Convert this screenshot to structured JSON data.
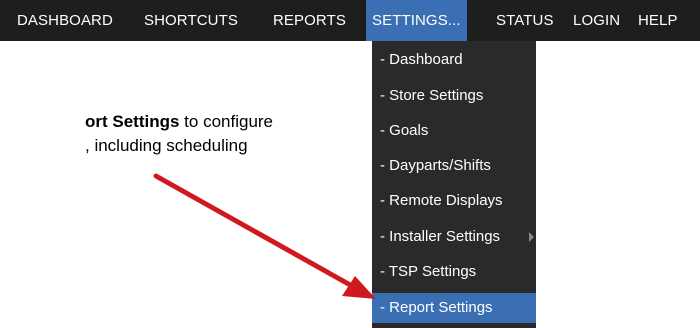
{
  "nav": {
    "items": [
      {
        "label": "DASHBOARD"
      },
      {
        "label": "SHORTCUTS"
      },
      {
        "label": "REPORTS"
      },
      {
        "label": "SETTINGS..."
      },
      {
        "label": "STATUS"
      },
      {
        "label": "LOGIN"
      },
      {
        "label": "HELP"
      }
    ],
    "active": "SETTINGS..."
  },
  "dropdown": {
    "items": [
      {
        "label": "- Dashboard"
      },
      {
        "label": "- Store Settings"
      },
      {
        "label": "- Goals"
      },
      {
        "label": "- Dayparts/Shifts"
      },
      {
        "label": "- Remote Displays"
      },
      {
        "label": "- Installer Settings"
      },
      {
        "label": "- TSP Settings"
      },
      {
        "label": "- Report Settings"
      }
    ],
    "highlighted": "- Report Settings"
  },
  "instruction": {
    "bold_part": "ort Settings",
    "rest_line1": " to configure",
    "line2": ", including scheduling"
  },
  "colors": {
    "navbar_bg": "#1e1e1e",
    "dropdown_bg": "#2a2a2a",
    "accent": "#3b6fb4",
    "arrow": "#d0191f"
  }
}
